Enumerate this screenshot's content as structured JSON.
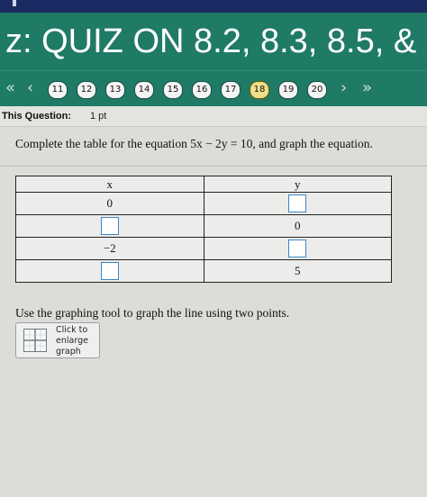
{
  "header": {
    "title": "z:  QUIZ ON 8.2, 8.3, 8.5, &"
  },
  "nav": {
    "first_icon": "double-left-arrow",
    "prev_icon": "left-arrow",
    "questions": [
      "11",
      "12",
      "13",
      "14",
      "15",
      "16",
      "17",
      "18",
      "19",
      "20"
    ],
    "current": "18",
    "next_icon": "right-arrow",
    "last_icon": "double-right-arrow"
  },
  "question": {
    "label": "This Question:",
    "points": "1 pt",
    "prompt": "Complete the table for the equation 5x − 2y = 10, and graph the equation.",
    "table": {
      "headers": [
        "x",
        "y"
      ],
      "rows": [
        {
          "x": "0",
          "y": ""
        },
        {
          "x": "",
          "y": "0"
        },
        {
          "x": "−2",
          "y": ""
        },
        {
          "x": "",
          "y": "5"
        }
      ]
    },
    "instruction": "Use the graphing tool to graph the line using two points.",
    "enlarge_label": [
      "Click to",
      "enlarge",
      "graph"
    ]
  },
  "colors": {
    "header_bg": "#1f7a66",
    "current_question": "#f1e08a",
    "answer_box_border": "#3b86c9"
  }
}
